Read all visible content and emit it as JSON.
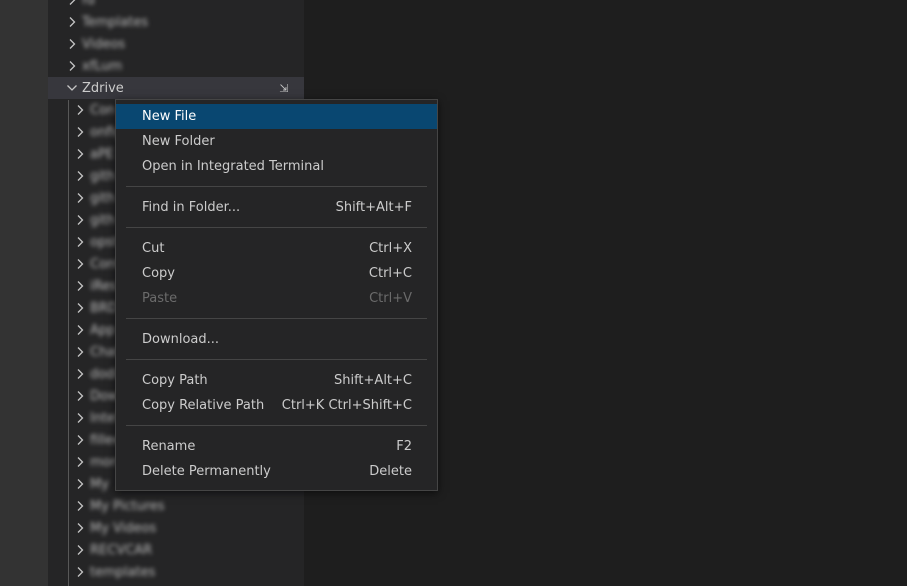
{
  "explorer": {
    "folder_open": "Zdrive",
    "rows_above": [
      "fd",
      "Templates",
      "Videos",
      "xfLum"
    ],
    "child_rows": [
      "Con",
      "onfig",
      "aPE",
      "gith",
      "gith",
      "gith",
      "opst",
      "Cont",
      "iRes",
      "BRD",
      "App",
      "Chat",
      "dodi",
      "Dow",
      "Intel",
      "fillee",
      "mon",
      "My",
      "My Pictures",
      "My Videos",
      "RECVCAR",
      "templates"
    ]
  },
  "context_menu": {
    "groups": [
      [
        {
          "label": "New File",
          "shortcut": "",
          "active": true
        },
        {
          "label": "New Folder",
          "shortcut": ""
        },
        {
          "label": "Open in Integrated Terminal",
          "shortcut": ""
        }
      ],
      [
        {
          "label": "Find in Folder...",
          "shortcut": "Shift+Alt+F"
        }
      ],
      [
        {
          "label": "Cut",
          "shortcut": "Ctrl+X"
        },
        {
          "label": "Copy",
          "shortcut": "Ctrl+C"
        },
        {
          "label": "Paste",
          "shortcut": "Ctrl+V",
          "disabled": true
        }
      ],
      [
        {
          "label": "Download...",
          "shortcut": ""
        }
      ],
      [
        {
          "label": "Copy Path",
          "shortcut": "Shift+Alt+C"
        },
        {
          "label": "Copy Relative Path",
          "shortcut": "Ctrl+K Ctrl+Shift+C"
        }
      ],
      [
        {
          "label": "Rename",
          "shortcut": "F2"
        },
        {
          "label": "Delete Permanently",
          "shortcut": "Delete"
        }
      ]
    ]
  },
  "colors": {
    "menu_active_bg": "#094771",
    "sidebar_bg": "#252526",
    "editor_bg": "#1e1e1e"
  }
}
